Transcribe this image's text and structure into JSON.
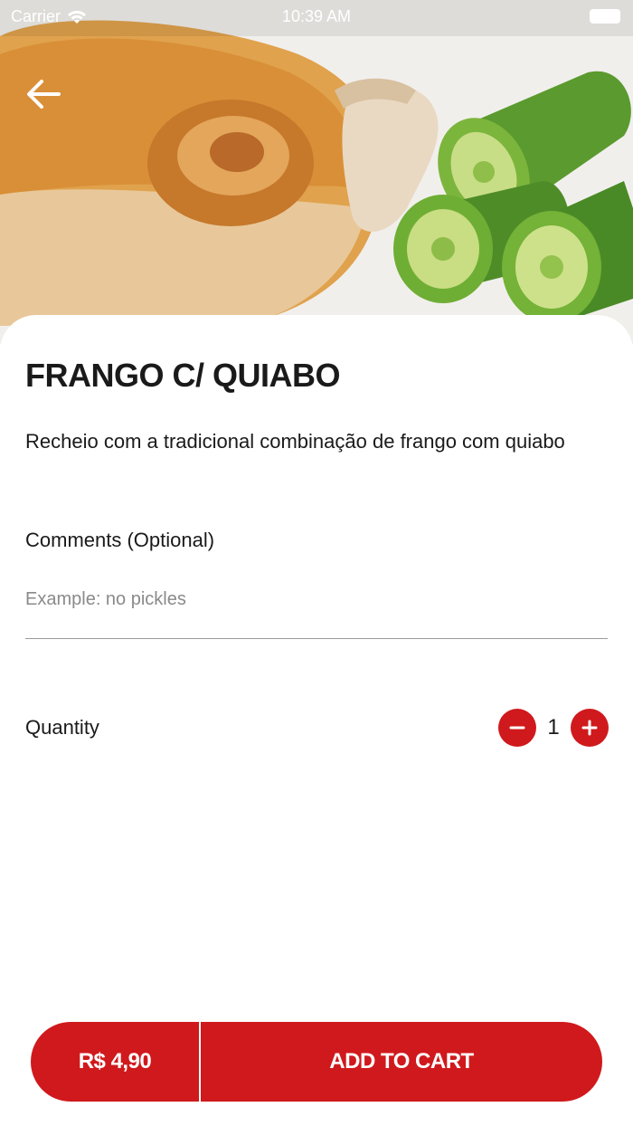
{
  "status_bar": {
    "carrier": "Carrier",
    "time": "10:39 AM"
  },
  "hero": {
    "icon": "back-arrow-icon"
  },
  "product": {
    "title": "FRANGO C/ QUIABO",
    "description": "Recheio com a tradicional combinação de frango com quiabo"
  },
  "comments": {
    "label": "Comments (Optional)",
    "placeholder": "Example: no pickles",
    "value": ""
  },
  "quantity": {
    "label": "Quantity",
    "value": "1",
    "decrement_icon": "minus-icon",
    "increment_icon": "plus-icon"
  },
  "cart": {
    "price": "R$ 4,90",
    "add_label": "ADD TO CART"
  },
  "colors": {
    "accent": "#d0191c",
    "text": "#1a1a1a",
    "placeholder": "#8a8a8a"
  }
}
